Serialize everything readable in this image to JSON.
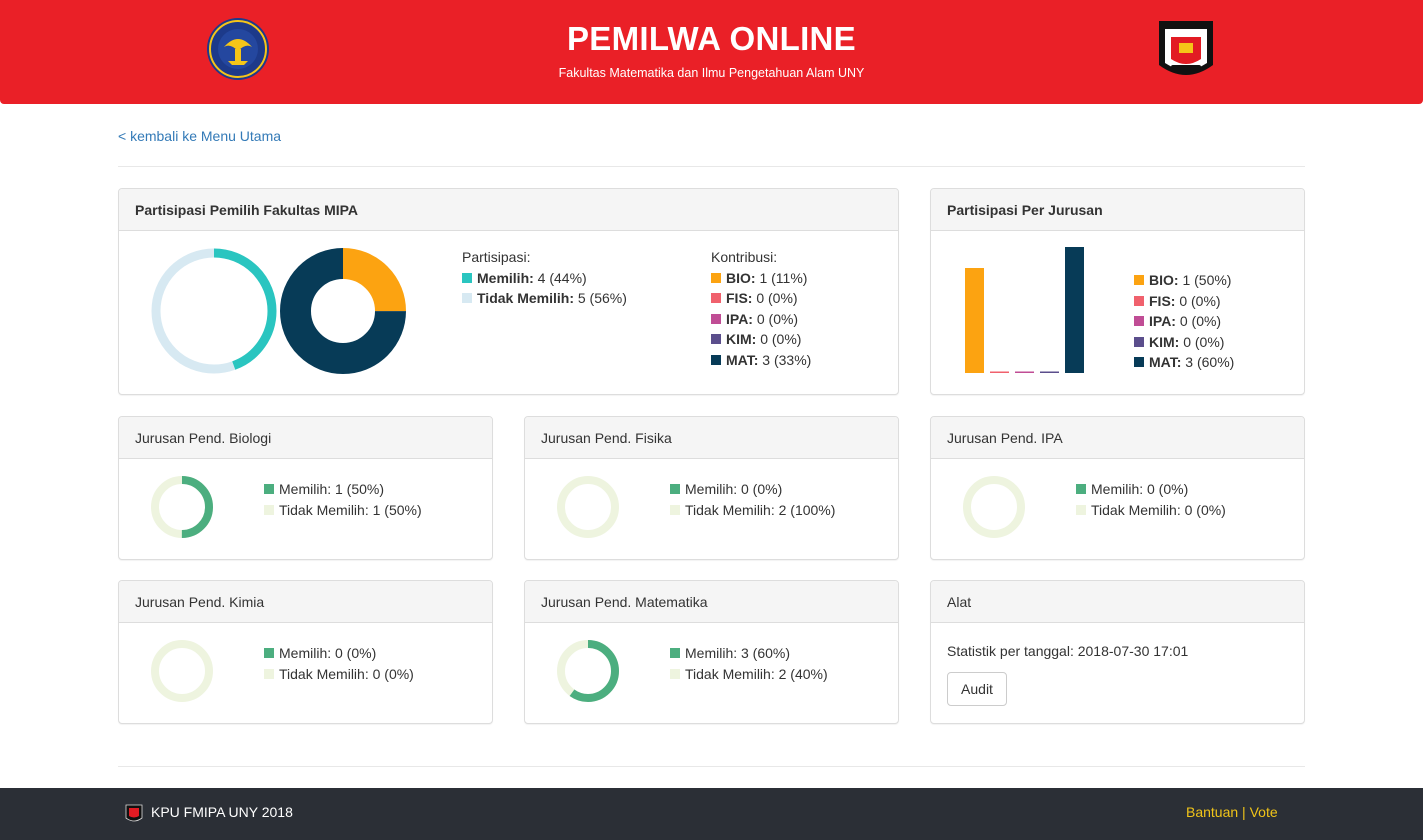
{
  "header": {
    "title": "PEMILWA ONLINE",
    "subtitle": "Fakultas Matematika dan Ilmu Pengetahuan Alam UNY",
    "logo_left_text": "UNIVERSITAS NEGERI YOGYAKARTA",
    "logo_right_text": "KOMISI PEMILIHAN UMUM FMIPA"
  },
  "nav": {
    "back_label": "< kembali ke Menu Utama"
  },
  "colors": {
    "header_bg": "#ea2027",
    "participated": "#2ac5c0",
    "not_participated": "#d7e9f2",
    "BIO": "#fca311",
    "FIS": "#f0616d",
    "IPA": "#c04d95",
    "KIM": "#5b4e8c",
    "MAT": "#073b57",
    "dept_memilih": "#4cae7f",
    "dept_tidak": "#eef4df",
    "footer_bg": "#2b2f36",
    "footer_link": "#f0c419"
  },
  "faculty_panel": {
    "title": "Partisipasi Pemilih Fakultas MIPA",
    "partisipasi_heading": "Partisipasi:",
    "partisipasi": [
      {
        "label": "Memilih:",
        "value": "4 (44%)",
        "count": 4
      },
      {
        "label": "Tidak Memilih:",
        "value": "5 (56%)",
        "count": 5
      }
    ],
    "kontribusi_heading": "Kontribusi:",
    "kontribusi": [
      {
        "label": "BIO:",
        "value": "1 (11%)",
        "count": 1
      },
      {
        "label": "FIS:",
        "value": "0 (0%)",
        "count": 0
      },
      {
        "label": "IPA:",
        "value": "0 (0%)",
        "count": 0
      },
      {
        "label": "KIM:",
        "value": "0 (0%)",
        "count": 0
      },
      {
        "label": "MAT:",
        "value": "3 (33%)",
        "count": 3
      }
    ]
  },
  "jurusan_panel": {
    "title": "Partisipasi Per Jurusan",
    "items": [
      {
        "label": "BIO:",
        "value": "1 (50%)"
      },
      {
        "label": "FIS:",
        "value": "0 (0%)"
      },
      {
        "label": "IPA:",
        "value": "0 (0%)"
      },
      {
        "label": "KIM:",
        "value": "0 (0%)"
      },
      {
        "label": "MAT:",
        "value": "3 (60%)"
      }
    ]
  },
  "chart_data": [
    {
      "type": "pie",
      "categories": [
        "Memilih",
        "Tidak Memilih"
      ],
      "values": [
        4,
        5
      ]
    },
    {
      "type": "pie",
      "categories": [
        "BIO",
        "FIS",
        "IPA",
        "KIM",
        "MAT"
      ],
      "values": [
        1,
        0,
        0,
        0,
        3
      ]
    },
    {
      "type": "bar",
      "categories": [
        "BIO",
        "FIS",
        "IPA",
        "KIM",
        "MAT"
      ],
      "values": [
        50,
        0,
        0,
        0,
        60
      ],
      "ylim": [
        0,
        60
      ]
    }
  ],
  "departments": [
    {
      "title": "Jurusan Pend. Biologi",
      "memilih_label": "Memilih: 1 (50%)",
      "tidak_label": "Tidak Memilih: 1 (50%)",
      "fraction": 0.5
    },
    {
      "title": "Jurusan Pend. Fisika",
      "memilih_label": "Memilih: 0 (0%)",
      "tidak_label": "Tidak Memilih: 2 (100%)",
      "fraction": 0
    },
    {
      "title": "Jurusan Pend. IPA",
      "memilih_label": "Memilih: 0 (0%)",
      "tidak_label": "Tidak Memilih: 0 (0%)",
      "fraction": 0
    },
    {
      "title": "Jurusan Pend. Kimia",
      "memilih_label": "Memilih: 0 (0%)",
      "tidak_label": "Tidak Memilih: 0 (0%)",
      "fraction": 0
    },
    {
      "title": "Jurusan Pend. Matematika",
      "memilih_label": "Memilih: 3 (60%)",
      "tidak_label": "Tidak Memilih: 2 (40%)",
      "fraction": 0.6
    }
  ],
  "tools": {
    "title": "Alat",
    "stat_text": "Statistik per tanggal: 2018-07-30 17:01",
    "audit_label": "Audit"
  },
  "footer": {
    "text": "KPU FMIPA UNY 2018",
    "help_label": "Bantuan",
    "separator": " | ",
    "vote_label": "Vote"
  }
}
